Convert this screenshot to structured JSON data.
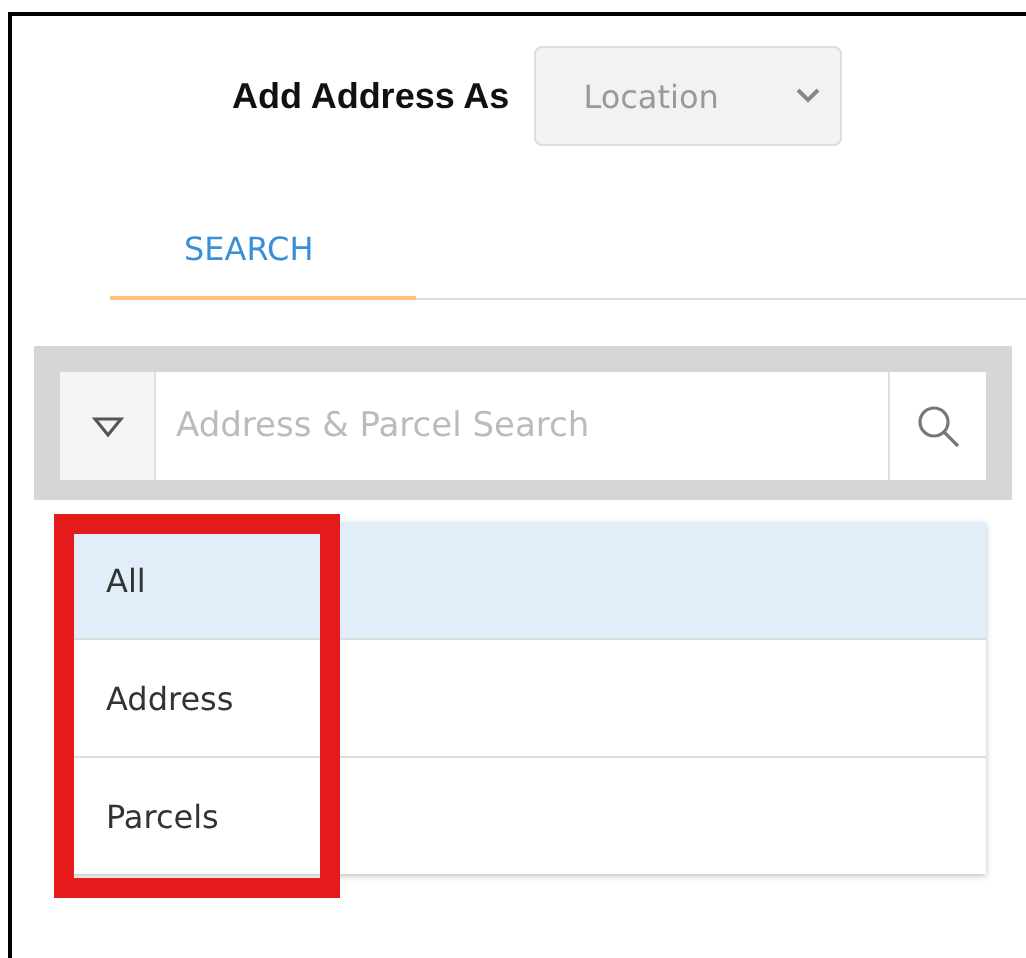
{
  "add_address": {
    "label": "Add Address As",
    "value": "Location"
  },
  "tabs": [
    {
      "label": "SEARCH",
      "selected": true
    }
  ],
  "search": {
    "placeholder": "Address & Parcel Search"
  },
  "options": [
    {
      "label": "All",
      "selected": true
    },
    {
      "label": "Address",
      "selected": false
    },
    {
      "label": "Parcels",
      "selected": false
    }
  ]
}
